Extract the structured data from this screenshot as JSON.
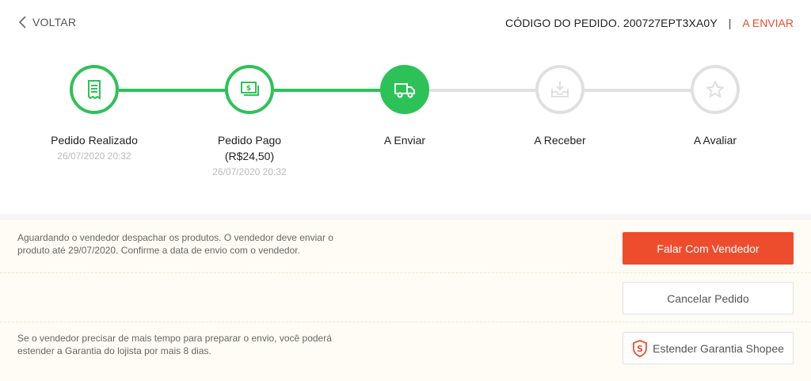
{
  "header": {
    "back_label": "VOLTAR",
    "order_code_label": "CÓDIGO DO PEDIDO. 200727EPT3XA0Y",
    "separator": "|",
    "status_label": "A ENVIAR"
  },
  "colors": {
    "accent": "#ee4d2d",
    "success": "#2dc258",
    "inactive": "#e0e0e0"
  },
  "steps": [
    {
      "icon": "receipt-icon",
      "label": "Pedido Realizado",
      "sub": "",
      "date": "26/07/2020 20:32",
      "state": "done"
    },
    {
      "icon": "money-icon",
      "label": "Pedido Pago",
      "sub": "(R$24,50)",
      "date": "26/07/2020 20:32",
      "state": "done"
    },
    {
      "icon": "truck-icon",
      "label": "A Enviar",
      "sub": "",
      "date": "",
      "state": "current"
    },
    {
      "icon": "inbox-download-icon",
      "label": "A Receber",
      "sub": "",
      "date": "",
      "state": "pending"
    },
    {
      "icon": "star-icon",
      "label": "A Avaliar",
      "sub": "",
      "date": "",
      "state": "pending"
    }
  ],
  "actions": {
    "message_line1": "Aguardando o vendedor despachar os produtos. O vendedor deve enviar o",
    "message_line2": "produto até 29/07/2020. Confirme a data de envio com o vendedor.",
    "chat_button": "Falar Com Vendedor",
    "cancel_button": "Cancelar Pedido",
    "guarantee_line1": "Se o vendedor precisar de mais tempo para preparar o envio, você poderá",
    "guarantee_line2": "estender a Garantia do lojista por mais 8 dias.",
    "guarantee_button": "Estender Garantia Shopee"
  }
}
